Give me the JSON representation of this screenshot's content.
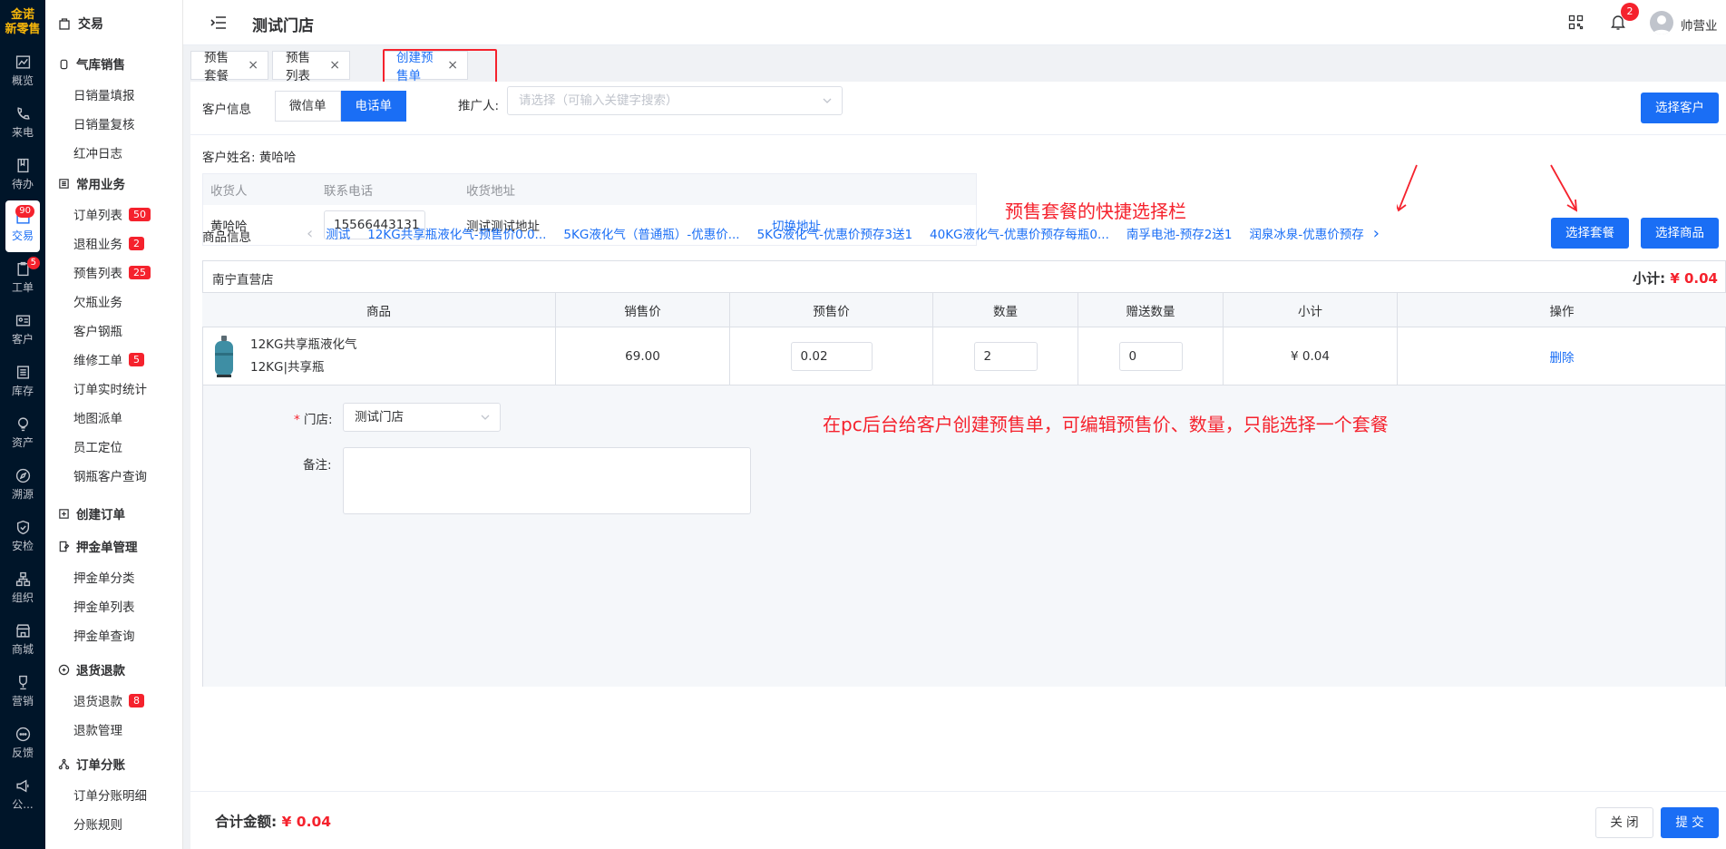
{
  "rail": {
    "logo_line1": "金诺",
    "logo_line2": "新零售",
    "items": [
      {
        "label": "概览",
        "icon": "chart-line-icon"
      },
      {
        "label": "来电",
        "icon": "phone-icon"
      },
      {
        "label": "待办",
        "icon": "book-icon"
      },
      {
        "label": "交易",
        "icon": "trade-icon",
        "badge": "90",
        "active": true
      },
      {
        "label": "工单",
        "icon": "clipboard-icon",
        "badge": "5"
      },
      {
        "label": "客户",
        "icon": "id-card-icon"
      },
      {
        "label": "库存",
        "icon": "list-icon"
      },
      {
        "label": "资产",
        "icon": "bulb-icon"
      },
      {
        "label": "溯源",
        "icon": "compass-icon"
      },
      {
        "label": "安检",
        "icon": "shield-icon"
      },
      {
        "label": "组织",
        "icon": "org-icon"
      },
      {
        "label": "商城",
        "icon": "shop-icon"
      },
      {
        "label": "营销",
        "icon": "trophy-icon"
      },
      {
        "label": "反馈",
        "icon": "chat-icon"
      },
      {
        "label": "公...",
        "icon": "megaphone-icon"
      }
    ]
  },
  "menu": {
    "title": "交易",
    "g1": "气库销售",
    "g1_items": [
      "日销量填报",
      "日销量复核",
      "红冲日志"
    ],
    "g2": "常用业务",
    "g2_items": [
      {
        "label": "订单列表",
        "badge": "50"
      },
      {
        "label": "退租业务",
        "badge": "2"
      },
      {
        "label": "预售列表",
        "badge": "25"
      },
      {
        "label": "欠瓶业务",
        "badge": ""
      },
      {
        "label": "客户钢瓶",
        "badge": ""
      },
      {
        "label": "维修工单",
        "badge": "5"
      },
      {
        "label": "订单实时统计",
        "badge": ""
      },
      {
        "label": "地图派单",
        "badge": ""
      },
      {
        "label": "员工定位",
        "badge": ""
      },
      {
        "label": "钢瓶客户查询",
        "badge": ""
      }
    ],
    "g3": "创建订单",
    "g4": "押金单管理",
    "g4_items": [
      "押金单分类",
      "押金单列表",
      "押金单查询"
    ],
    "g5": "退货退款",
    "g5_items": [
      {
        "label": "退货退款",
        "badge": "8"
      },
      {
        "label": "退款管理",
        "badge": ""
      }
    ],
    "g6": "订单分账",
    "g6_items": [
      "订单分账明细",
      "分账规则"
    ]
  },
  "topbar": {
    "title": "测试门店",
    "bell_badge": "2",
    "user": "帅营业"
  },
  "tabs": [
    {
      "label": "预售套餐",
      "close": "×"
    },
    {
      "label": "预售列表",
      "close": "×"
    },
    {
      "label": "创建预售单",
      "close": "×"
    }
  ],
  "customer": {
    "label": "客户信息",
    "seg_wechat": "微信单",
    "seg_phone": "电话单",
    "promoter_label": "推广人:",
    "promoter_placeholder": "请选择（可输入关键字搜索）",
    "select_customer": "选择客户",
    "name_label": "客户姓名:",
    "name": "黄哈哈"
  },
  "address": {
    "col_receiver": "收货人",
    "col_phone": "联系电话",
    "col_address": "收货地址",
    "receiver": "黄哈哈",
    "phone": "15566443131",
    "address": "测试测试地址",
    "switch": "切换地址"
  },
  "annotations": {
    "quick_bar": "预售套餐的快捷选择栏",
    "description": "在pc后台给客户创建预售单，可编辑预售价、数量，只能选择一个套餐"
  },
  "products": {
    "label": "商品信息",
    "quick_items": [
      "测试",
      "12KG共享瓶液化气-预售价0.0...",
      "5KG液化气（普通瓶）-优惠价...",
      "5KG液化气-优惠价预存3送1",
      "40KG液化气-优惠价预存每瓶0...",
      "南孚电池-预存2送1",
      "润泉冰泉-优惠价预存"
    ],
    "select_package": "选择套餐",
    "select_product": "选择商品"
  },
  "store_box": {
    "store": "南宁直营店",
    "subtotal_label": "小计:",
    "subtotal": "¥ 0.04",
    "headers": [
      "商品",
      "销售价",
      "预售价",
      "数量",
      "赠送数量",
      "小计",
      "操作"
    ],
    "row": {
      "name": "12KG共享瓶液化气",
      "spec": "12KG|共享瓶",
      "sale_price": "69.00",
      "presale_price": "0.02",
      "qty": "2",
      "gift_qty": "0",
      "subtotal": "¥ 0.04",
      "action": "删除"
    },
    "store_field_label": "门店:",
    "store_field_value": "测试门店",
    "remark_label": "备注:"
  },
  "footer": {
    "total_label": "合计金额:",
    "total": "¥ 0.04",
    "close": "关 闭",
    "submit": "提 交"
  }
}
